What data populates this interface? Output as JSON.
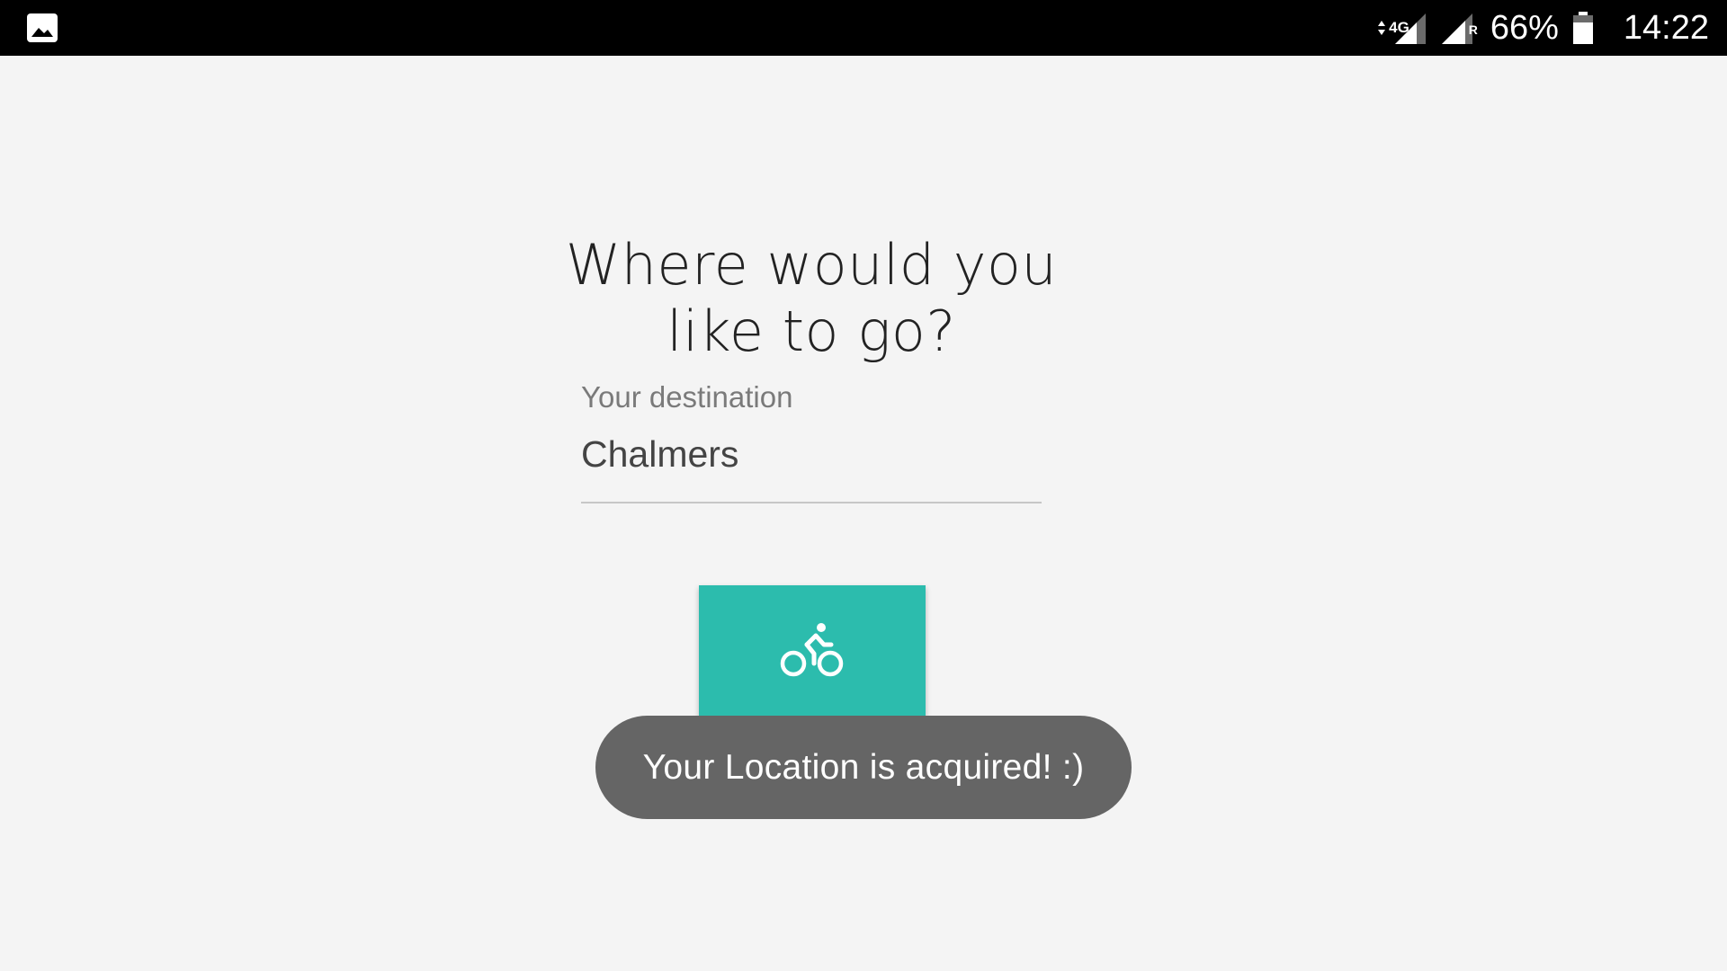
{
  "status_bar": {
    "left_icon": "image-icon",
    "network_label": "4G",
    "signal_icon": "signal-icon",
    "roaming_signal_icon": "roaming-signal-icon",
    "roaming_label": "R",
    "battery_percent": "66%",
    "battery_icon": "battery-icon",
    "time": "14:22"
  },
  "main": {
    "headline_line1": "Where would you",
    "headline_line2": "like to go?",
    "destination_field": {
      "label": "Your destination",
      "value": "Chalmers"
    },
    "bike_button_icon": "bicycle-icon"
  },
  "toast": {
    "message": "Your Location is acquired! :)"
  },
  "colors": {
    "background": "#f4f4f4",
    "status_bar": "#000000",
    "accent": "#2cbcad",
    "toast_bg": "#656565"
  }
}
